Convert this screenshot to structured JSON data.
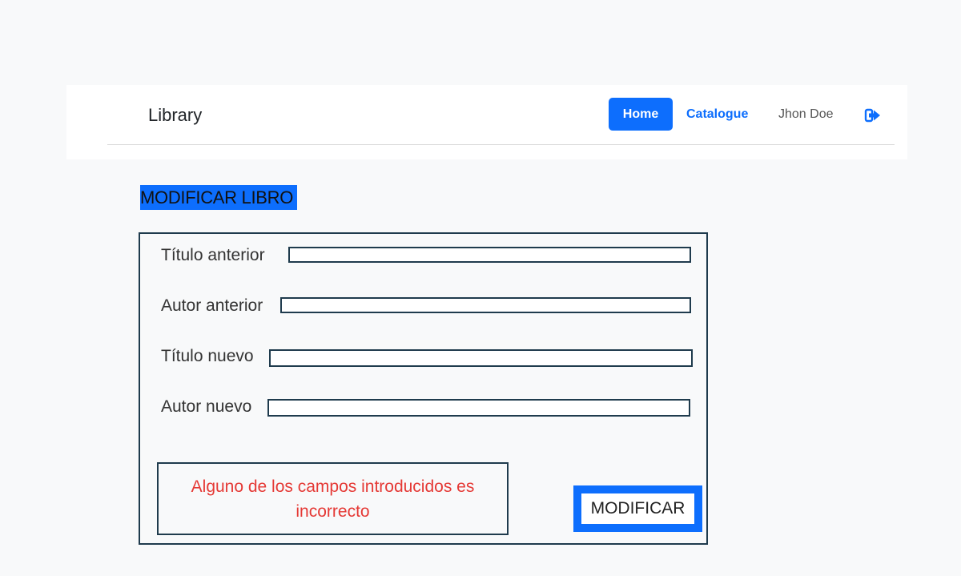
{
  "navbar": {
    "brand": "Library",
    "items": [
      {
        "label": "Home",
        "active": true
      },
      {
        "label": "Catalogue"
      },
      {
        "label": "Jhon Doe"
      }
    ],
    "logout_icon": "sign-out-icon",
    "accent_color": "#0d6efd"
  },
  "page": {
    "heading": "MODIFICAR LIBRO"
  },
  "form": {
    "fields": [
      {
        "label": "Título anterior",
        "value": ""
      },
      {
        "label": "Autor anterior",
        "value": ""
      },
      {
        "label": "Título nuevo",
        "value": ""
      },
      {
        "label": "Autor nuevo",
        "value": ""
      }
    ],
    "error_message": "Alguno de los campos introducidos es incorrecto",
    "error_color": "#e53935",
    "submit_label": "MODIFICAR"
  }
}
